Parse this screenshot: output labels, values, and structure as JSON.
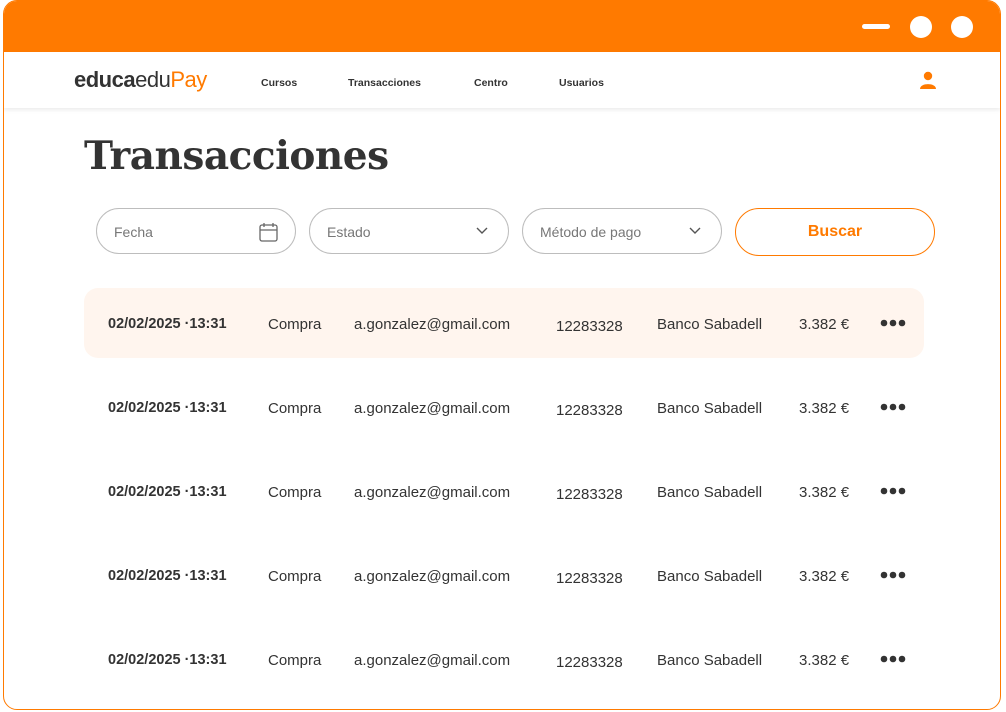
{
  "brand": {
    "part1": "educa",
    "part2": "edu",
    "part3": "Pay"
  },
  "nav": {
    "items": [
      "Cursos",
      "Transacciones",
      "Centro",
      "Usuarios"
    ]
  },
  "page": {
    "title": "Transacciones"
  },
  "filters": {
    "date_placeholder": "Fecha",
    "status_placeholder": "Estado",
    "method_placeholder": "Método de pago",
    "search_label": "Buscar"
  },
  "transactions": [
    {
      "date": "02/02/2025 ·13:31",
      "type": "Compra",
      "email": "a.gonzalez@gmail.com",
      "ref": "12283328",
      "bank": "Banco Sabadell",
      "amount": "3.382 €"
    },
    {
      "date": "02/02/2025 ·13:31",
      "type": "Compra",
      "email": "a.gonzalez@gmail.com",
      "ref": "12283328",
      "bank": "Banco Sabadell",
      "amount": "3.382 €"
    },
    {
      "date": "02/02/2025 ·13:31",
      "type": "Compra",
      "email": "a.gonzalez@gmail.com",
      "ref": "12283328",
      "bank": "Banco Sabadell",
      "amount": "3.382 €"
    },
    {
      "date": "02/02/2025 ·13:31",
      "type": "Compra",
      "email": "a.gonzalez@gmail.com",
      "ref": "12283328",
      "bank": "Banco Sabadell",
      "amount": "3.382 €"
    },
    {
      "date": "02/02/2025 ·13:31",
      "type": "Compra",
      "email": "a.gonzalez@gmail.com",
      "ref": "12283328",
      "bank": "Banco Sabadell",
      "amount": "3.382 €"
    }
  ],
  "icons": {
    "date": "calendar-icon",
    "dropdown": "chevron-down-icon",
    "user": "user-icon",
    "more": "more-horizontal-icon"
  },
  "colors": {
    "accent": "#ff7a00",
    "row_highlight": "#fff5ee",
    "text": "#333333"
  }
}
